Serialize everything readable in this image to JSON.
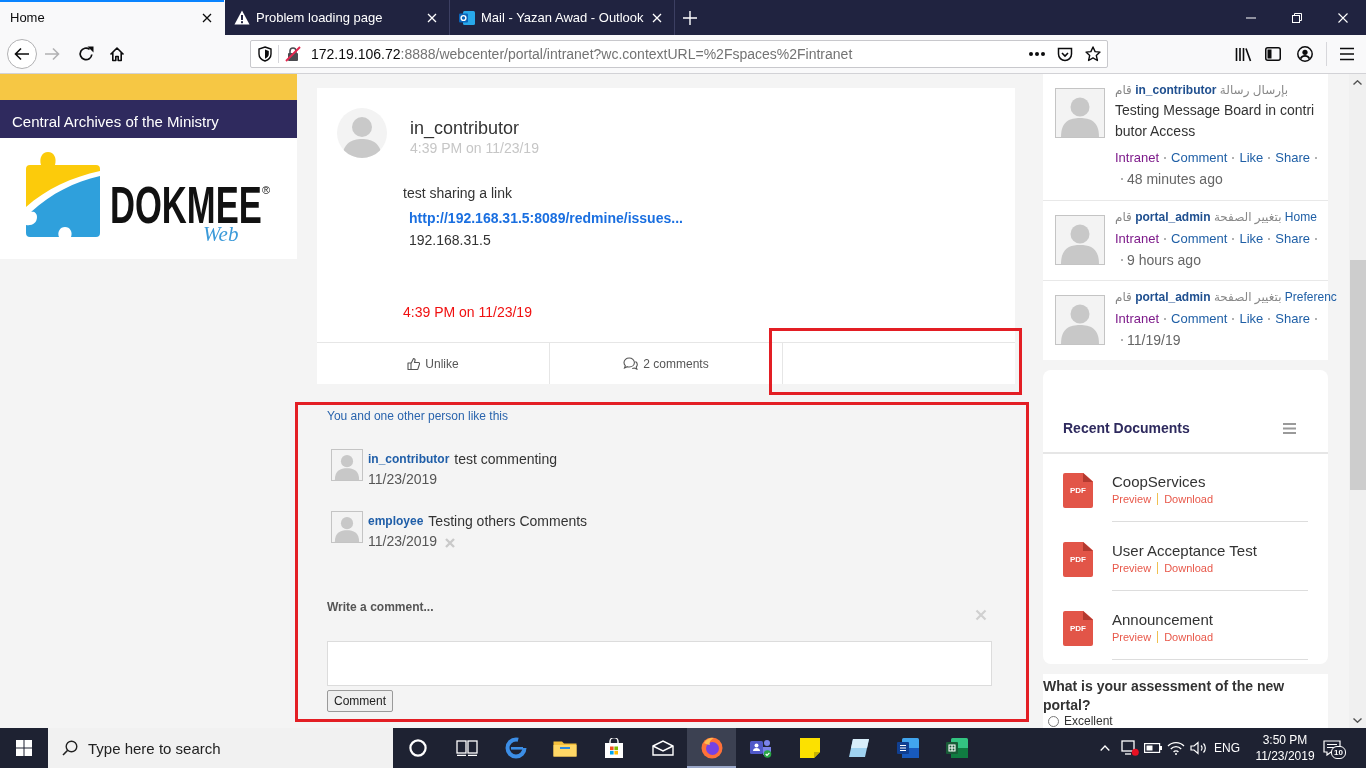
{
  "browser": {
    "tabs": [
      {
        "title": "Home",
        "kind": "page",
        "selected": true
      },
      {
        "title": "Problem loading page",
        "kind": "warning",
        "selected": false
      },
      {
        "title": "Mail - Yazan Awad - Outlook",
        "kind": "mail",
        "selected": false
      }
    ],
    "address": {
      "host": "172.19.106.72",
      "rest": ":8888/webcenter/portal/intranet?wc.contextURL=%2Fspaces%2Fintranet"
    }
  },
  "sidebar": {
    "banner": "Central Archives of the Ministry",
    "logo": {
      "wordmark": "DOKMEE",
      "registered": "®",
      "tagline": "Web"
    }
  },
  "post": {
    "author": "in_contributor",
    "posted": "4:39 PM on 11/23/19",
    "text": "test sharing a link",
    "link": {
      "title": "http://192.168.31.5:8089/redmine/issues...",
      "host": "192.168.31.5"
    },
    "footer_time": "4:39 PM on 11/23/19",
    "actions": [
      {
        "kind": "like",
        "label": "Unlike",
        "highlighted": false
      },
      {
        "kind": "comments",
        "label": "2 comments",
        "highlighted": false
      },
      {
        "kind": "blank",
        "highlighted": true
      }
    ]
  },
  "comments_panel": {
    "highlighted": true,
    "likes": "You and one other person like this",
    "comments": [
      {
        "author": "in_contributor",
        "text": "test commenting",
        "date": "11/23/2019",
        "deletable": false
      },
      {
        "author": "employee",
        "text": "Testing others Comments",
        "date": "11/23/2019",
        "deletable": true
      }
    ],
    "form": {
      "label": "Write a comment...",
      "button": "Comment"
    }
  },
  "activity": [
    {
      "prefix": "قام",
      "actor": "in_contributor",
      "action": "بإرسال رسالة",
      "message": "Testing Message Board in contributor Access",
      "links": [
        {
          "label": "Intranet",
          "visited": true
        },
        {
          "label": "Comment",
          "visited": false
        },
        {
          "label": "Like",
          "visited": false
        },
        {
          "label": "Share",
          "visited": false
        }
      ],
      "time": "48 minutes ago"
    },
    {
      "prefix": "قام",
      "actor": "portal_admin",
      "action": "بتغيير الصفحة",
      "target": "Home",
      "links": [
        {
          "label": "Intranet",
          "visited": true
        },
        {
          "label": "Comment",
          "visited": false
        },
        {
          "label": "Like",
          "visited": false
        },
        {
          "label": "Share",
          "visited": false
        }
      ],
      "time": "9 hours ago"
    },
    {
      "prefix": "قام",
      "actor": "portal_admin",
      "action": "بتغيير الصفحة",
      "target": "Preferenc",
      "links": [
        {
          "label": "Intranet",
          "visited": true
        },
        {
          "label": "Comment",
          "visited": false
        },
        {
          "label": "Like",
          "visited": false
        },
        {
          "label": "Share",
          "visited": false
        }
      ],
      "time": "11/19/19"
    }
  ],
  "recent_documents": {
    "title": "Recent Documents",
    "items": [
      {
        "name": "CoopServices",
        "type": "PDF",
        "actions": [
          "Preview",
          "Download"
        ]
      },
      {
        "name": "User Acceptance Test",
        "type": "PDF",
        "actions": [
          "Preview",
          "Download"
        ]
      },
      {
        "name": "Announcement",
        "type": "PDF",
        "actions": [
          "Preview",
          "Download"
        ]
      }
    ]
  },
  "poll": {
    "question": "What is your assessment of the new portal?",
    "options": [
      {
        "label": "Excellent",
        "selected": false
      }
    ]
  },
  "taskbar": {
    "search": {
      "placeholder": "Type here to search"
    },
    "apps": [
      {
        "kind": "cortana",
        "active": false
      },
      {
        "kind": "taskview",
        "active": false
      },
      {
        "kind": "edge",
        "active": false
      },
      {
        "kind": "explorer",
        "active": false
      },
      {
        "kind": "store",
        "active": false
      },
      {
        "kind": "mail",
        "active": false
      },
      {
        "kind": "firefox",
        "active": true
      },
      {
        "kind": "teams",
        "active": false
      },
      {
        "kind": "sticky",
        "active": false
      },
      {
        "kind": "app",
        "active": false
      },
      {
        "kind": "word",
        "active": false
      },
      {
        "kind": "excel",
        "active": false
      }
    ],
    "language": "ENG",
    "time": "3:50 PM",
    "date": "11/23/2019",
    "notifications": "10"
  }
}
